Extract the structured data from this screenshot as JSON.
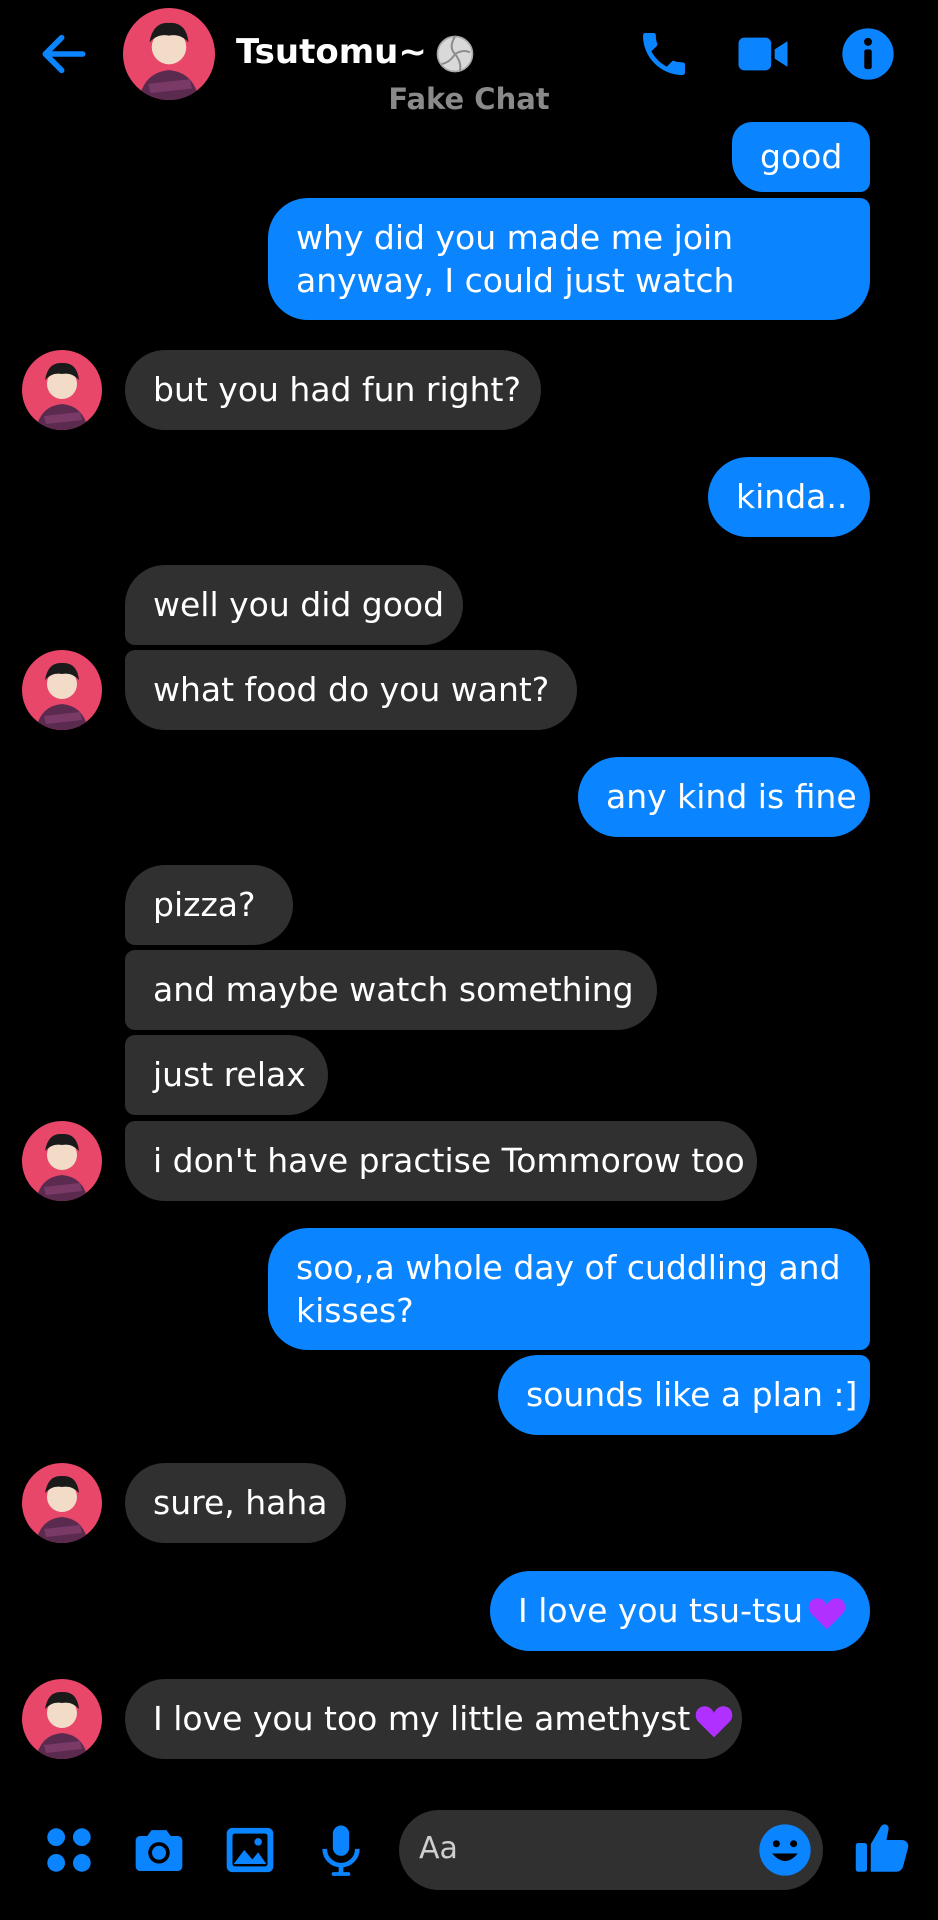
{
  "header": {
    "contact_name": "Tsutomu~",
    "subtitle": "Fake Chat",
    "back_icon": "arrow-left-icon",
    "call_icon": "phone-icon",
    "video_icon": "video-camera-icon",
    "info_icon": "info-icon",
    "accent_color": "#0a84ff"
  },
  "messages": [
    {
      "dir": "out",
      "text": "good"
    },
    {
      "dir": "out",
      "text": "why did you made me join anyway, I could just watch"
    },
    {
      "dir": "in",
      "text": "but you had fun right?"
    },
    {
      "dir": "out",
      "text": "kinda.."
    },
    {
      "dir": "in",
      "text": "well you did good"
    },
    {
      "dir": "in",
      "text": "what food do you want?"
    },
    {
      "dir": "out",
      "text": "any kind is fine"
    },
    {
      "dir": "in",
      "text": "pizza?"
    },
    {
      "dir": "in",
      "text": "and maybe watch something"
    },
    {
      "dir": "in",
      "text": "just relax"
    },
    {
      "dir": "in",
      "text": "i don't have practise Tommorow too"
    },
    {
      "dir": "out",
      "text": "soo,,a whole day of cuddling and kisses?"
    },
    {
      "dir": "out",
      "text": "sounds like a plan :]"
    },
    {
      "dir": "in",
      "text": "sure, haha"
    },
    {
      "dir": "out",
      "text": "I love you tsu-tsu"
    },
    {
      "dir": "in",
      "text": "I love you too my little amethyst"
    }
  ],
  "composer": {
    "placeholder": "Aa",
    "icons": [
      "apps-icon",
      "camera-icon",
      "gallery-icon",
      "microphone-icon",
      "emoji-icon",
      "thumbs-up-icon"
    ]
  }
}
